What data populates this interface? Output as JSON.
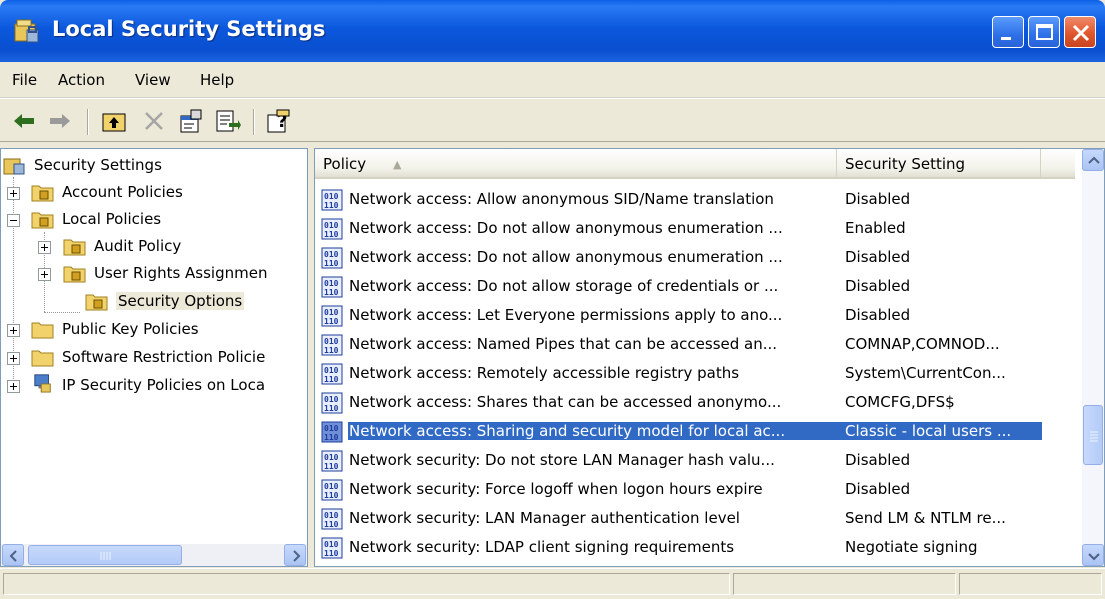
{
  "window": {
    "title": "Local Security Settings",
    "title_bar_color": "#0b58dc",
    "close_button_color": "#e0572e"
  },
  "menu": {
    "file": "File",
    "action": "Action",
    "view": "View",
    "help": "Help"
  },
  "tree": {
    "root": "Security Settings",
    "account_policies": "Account Policies",
    "local_policies": "Local Policies",
    "audit_policy": "Audit Policy",
    "user_rights": "User Rights Assignmen",
    "security_options": "Security Options",
    "public_key": "Public Key Policies",
    "software_restriction": "Software Restriction Policie",
    "ip_security": "IP Security Policies on Loca"
  },
  "list": {
    "columns": {
      "policy": "Policy",
      "setting": "Security Setting"
    },
    "selection_color": "#316ac5",
    "rows": [
      {
        "policy": "Network access: Allow anonymous SID/Name translation",
        "setting": "Disabled"
      },
      {
        "policy": "Network access: Do not allow anonymous enumeration ...",
        "setting": "Enabled"
      },
      {
        "policy": "Network access: Do not allow anonymous enumeration ...",
        "setting": "Disabled"
      },
      {
        "policy": "Network access: Do not allow storage of credentials or ...",
        "setting": "Disabled"
      },
      {
        "policy": "Network access: Let Everyone permissions apply to ano...",
        "setting": "Disabled"
      },
      {
        "policy": "Network access: Named Pipes that can be accessed an...",
        "setting": "COMNAP,COMNOD..."
      },
      {
        "policy": "Network access: Remotely accessible registry paths",
        "setting": "System\\CurrentCon..."
      },
      {
        "policy": "Network access: Shares that can be accessed anonymo...",
        "setting": "COMCFG,DFS$"
      },
      {
        "policy": "Network access: Sharing and security model for local ac...",
        "setting": "Classic - local users ..."
      },
      {
        "policy": "Network security: Do not store LAN Manager hash valu...",
        "setting": "Disabled"
      },
      {
        "policy": "Network security: Force logoff when logon hours expire",
        "setting": "Disabled"
      },
      {
        "policy": "Network security: LAN Manager authentication level",
        "setting": "Send LM & NTLM re..."
      },
      {
        "policy": "Network security: LDAP client signing requirements",
        "setting": "Negotiate signing"
      }
    ]
  },
  "icons": {
    "app": "security-settings-icon",
    "back": "back-arrow-icon",
    "forward": "forward-arrow-icon",
    "up": "up-folder-icon",
    "delete": "delete-x-icon",
    "properties": "properties-icon",
    "export": "export-list-icon",
    "help": "help-icon",
    "policy": "policy-binary-icon",
    "folder": "folder-icon",
    "lock_folder": "locked-folder-icon"
  }
}
